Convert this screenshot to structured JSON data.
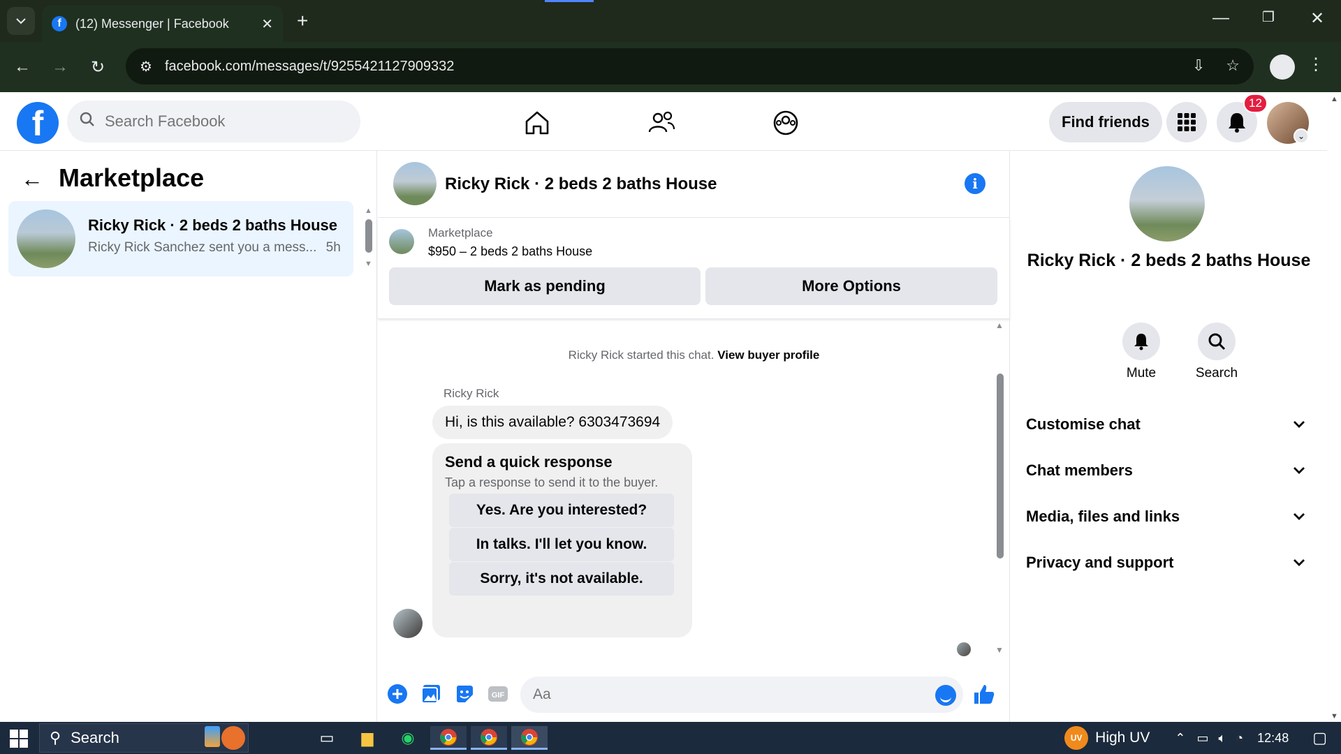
{
  "browser": {
    "tab_title": "(12) Messenger | Facebook",
    "url": "facebook.com/messages/t/9255421127909332"
  },
  "header": {
    "search_placeholder": "Search Facebook",
    "find_friends": "Find friends",
    "notification_count": "12"
  },
  "left": {
    "title": "Marketplace",
    "threads": [
      {
        "name": "Ricky Rick · 2 beds 2 baths House",
        "snippet": "Ricky Rick Sanchez sent you a mess...",
        "time": "5h"
      }
    ]
  },
  "chat": {
    "title": "Ricky Rick · 2 beds 2 baths House",
    "listing": {
      "label": "Marketplace",
      "price_title": "$950 – 2 beds 2 baths House",
      "mark_pending": "Mark as pending",
      "more_options": "More Options"
    },
    "started_text": "Ricky Rick started this chat.",
    "view_buyer": "View buyer profile",
    "sender_name": "Ricky Rick",
    "message": "Hi, is this available? 6303473694",
    "quick": {
      "title": "Send a quick response",
      "subtitle": "Tap a response to send it to the buyer.",
      "options": [
        "Yes. Are you interested?",
        "In talks. I'll let you know.",
        "Sorry, it's not available."
      ]
    },
    "composer_placeholder": "Aa"
  },
  "info": {
    "name": "Ricky Rick · 2 beds 2 baths House",
    "mute": "Mute",
    "search": "Search",
    "sections": [
      "Customise chat",
      "Chat members",
      "Media, files and links",
      "Privacy and support"
    ]
  },
  "taskbar": {
    "search": "Search",
    "weather": "High UV",
    "weather_badge": "UV",
    "time": "12:48"
  },
  "colors": {
    "facebook_blue": "#1877f2",
    "selected_thread_bg": "#ebf5ff",
    "notification_red": "#e41e3f"
  }
}
